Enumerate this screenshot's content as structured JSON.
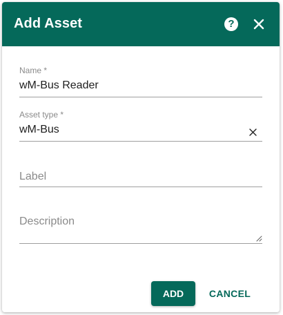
{
  "dialog": {
    "title": "Add Asset",
    "help_icon": "help-circle-icon",
    "close_icon": "close-icon"
  },
  "form": {
    "name": {
      "label": "Name *",
      "value": "wM-Bus Reader"
    },
    "asset_type": {
      "label": "Asset type *",
      "value": "wM-Bus",
      "clear_icon": "clear-icon"
    },
    "label_field": {
      "placeholder": "Label"
    },
    "description": {
      "placeholder": "Description",
      "resize_icon": "resize-handle-icon"
    }
  },
  "actions": {
    "add_label": "ADD",
    "cancel_label": "CANCEL"
  },
  "colors": {
    "primary": "#05695a",
    "underline": "#9e9e9e",
    "label_text": "#8a8a8a",
    "value_text": "#202020"
  }
}
